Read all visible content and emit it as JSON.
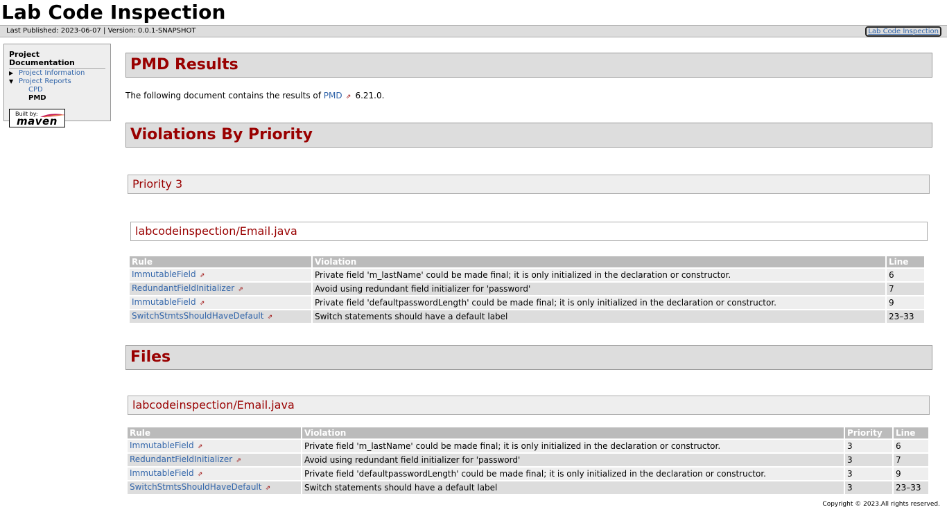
{
  "header": {
    "title": "Lab Code Inspection"
  },
  "breadcrumbs": {
    "published_label": "Last Published: 2023-06-07",
    "separator": "|",
    "version_label": "Version: 0.0.1-SNAPSHOT",
    "right_link": "Lab Code Inspection"
  },
  "sidebar": {
    "heading": "Project Documentation",
    "items": [
      {
        "label": "Project Information"
      },
      {
        "label": "Project Reports"
      },
      {
        "label": "CPD"
      },
      {
        "label": "PMD"
      }
    ],
    "badge": {
      "built_by": "Built by:",
      "word": "maven"
    }
  },
  "main": {
    "title": "PMD Results",
    "intro_prefix": "The following document contains the results of",
    "intro_link": "PMD",
    "intro_suffix": "6.21.0.",
    "by_priority": {
      "title": "Violations By Priority",
      "priority_heading": "Priority 3",
      "file_heading": "labcodeinspection/Email.java",
      "columns": [
        "Rule",
        "Violation",
        "Line"
      ],
      "rows": [
        {
          "rule": "ImmutableField",
          "violation": "Private field 'm_lastName' could be made final; it is only initialized in the declaration or constructor.",
          "line": "6"
        },
        {
          "rule": "RedundantFieldInitializer",
          "violation": "Avoid using redundant field initializer for 'password'",
          "line": "7"
        },
        {
          "rule": "ImmutableField",
          "violation": "Private field 'defaultpasswordLength' could be made final; it is only initialized in the declaration or constructor.",
          "line": "9"
        },
        {
          "rule": "SwitchStmtsShouldHaveDefault",
          "violation": "Switch statements should have a default label",
          "line": "23–33"
        }
      ]
    },
    "files": {
      "title": "Files",
      "file_heading": "labcodeinspection/Email.java",
      "columns": [
        "Rule",
        "Violation",
        "Priority",
        "Line"
      ],
      "rows": [
        {
          "rule": "ImmutableField",
          "violation": "Private field 'm_lastName' could be made final; it is only initialized in the declaration or constructor.",
          "priority": "3",
          "line": "6"
        },
        {
          "rule": "RedundantFieldInitializer",
          "violation": "Avoid using redundant field initializer for 'password'",
          "priority": "3",
          "line": "7"
        },
        {
          "rule": "ImmutableField",
          "violation": "Private field 'defaultpasswordLength' could be made final; it is only initialized in the declaration or constructor.",
          "priority": "3",
          "line": "9"
        },
        {
          "rule": "SwitchStmtsShouldHaveDefault",
          "violation": "Switch statements should have a default label",
          "priority": "3",
          "line": "23–33"
        }
      ]
    }
  },
  "footer": {
    "copyright": "Copyright © 2023.All rights reserved."
  },
  "icons": {
    "external_link": "external-link-icon",
    "collapsed_arrow": "triangle-right-icon",
    "expanded_arrow": "triangle-down-icon"
  },
  "colors": {
    "heading": "#990000",
    "link": "#3366aa",
    "table_header": "#bbbbbb"
  }
}
